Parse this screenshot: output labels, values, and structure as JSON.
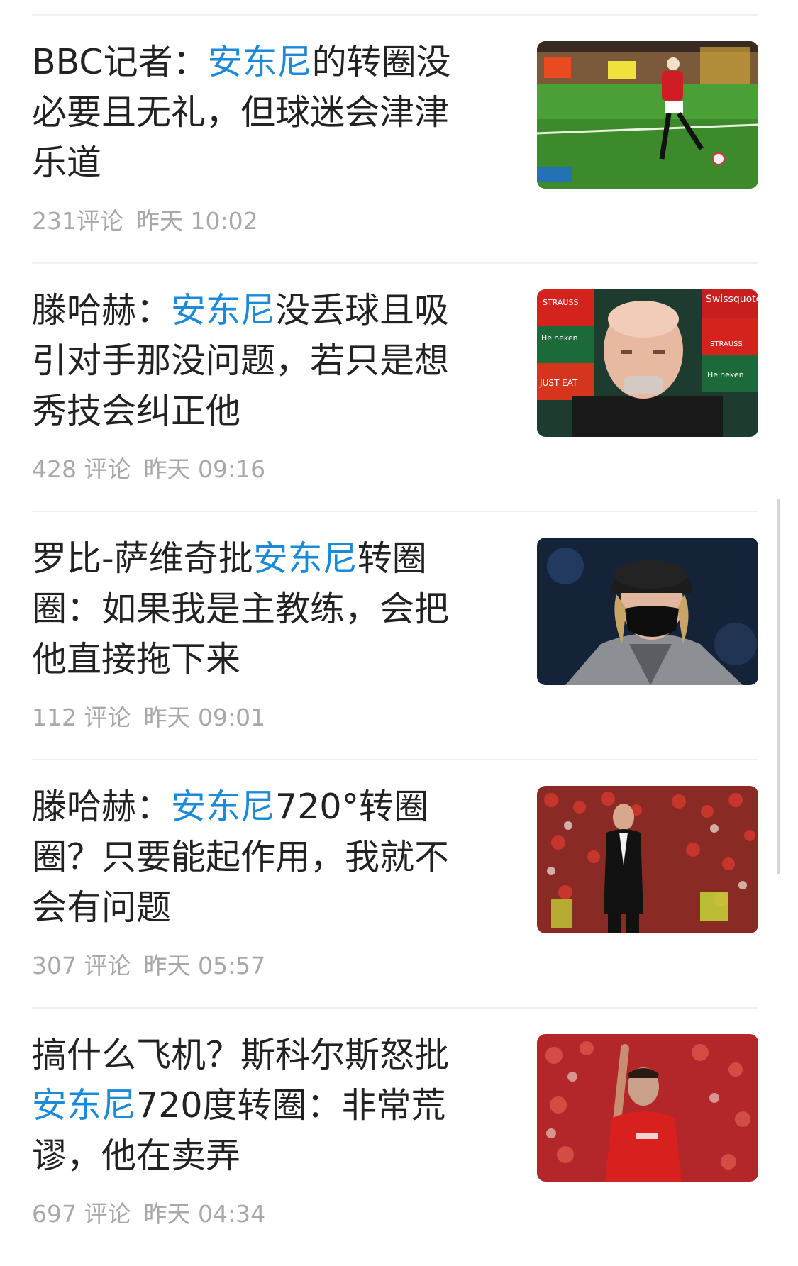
{
  "highlight_color": "#1b8ad8",
  "news": [
    {
      "headline": [
        {
          "text": "BBC记者：",
          "hl": false
        },
        {
          "text": "安东尼",
          "hl": true
        },
        {
          "text": "的转圈没必要且无礼，但球迷会津津乐道",
          "hl": false
        }
      ],
      "comments": "231评论",
      "time": "昨天 10:02",
      "image": "football-pitch-dribble-image"
    },
    {
      "headline": [
        {
          "text": "滕哈赫：",
          "hl": false
        },
        {
          "text": "安东尼",
          "hl": true
        },
        {
          "text": "没丢球且吸引对手那没问题，若只是想秀技会纠正他",
          "hl": false
        }
      ],
      "comments": "428 评论",
      "time": "昨天 09:16",
      "image": "press-conference-image",
      "sponsor_labels": [
        "STRAUSS",
        "Swissquote",
        "Heineken",
        "JUST EAT",
        "STRAUSS",
        "Heineken"
      ]
    },
    {
      "headline": [
        {
          "text": "罗比-萨维奇批",
          "hl": false
        },
        {
          "text": "安东尼",
          "hl": true
        },
        {
          "text": "转圈圈：如果我是主教练，会把他直接拖下来",
          "hl": false
        }
      ],
      "comments": "112 评论",
      "time": "昨天 09:01",
      "image": "masked-man-in-cap-image"
    },
    {
      "headline": [
        {
          "text": "滕哈赫：",
          "hl": false
        },
        {
          "text": "安东尼",
          "hl": true
        },
        {
          "text": "720°转圈圈？只要能起作用，我就不会有问题",
          "hl": false
        }
      ],
      "comments": "307 评论",
      "time": "昨天 05:57",
      "image": "manager-in-stadium-image"
    },
    {
      "headline": [
        {
          "text": "搞什么飞机？斯科尔斯怒批",
          "hl": false
        },
        {
          "text": "安东尼",
          "hl": true
        },
        {
          "text": "720度转圈：非常荒谬，他在卖弄",
          "hl": false
        }
      ],
      "comments": "697 评论",
      "time": "昨天 04:34",
      "image": "player-pointing-up-image"
    }
  ]
}
